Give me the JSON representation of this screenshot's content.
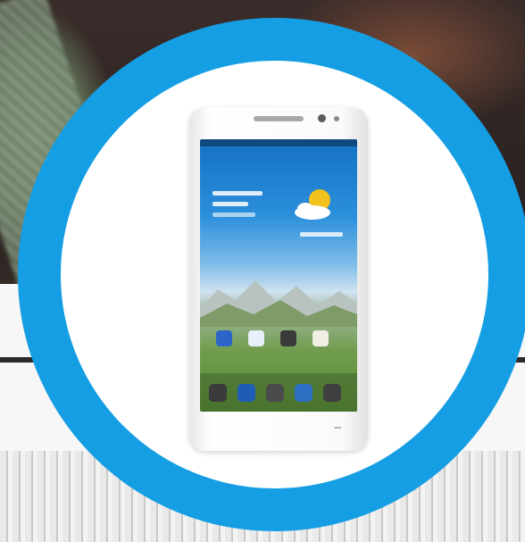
{
  "image": {
    "subject": "smartphone-in-blue-circle",
    "colors": {
      "ring": "#159ee3",
      "ring_inner": "#ffffff",
      "phone_body": "#fafafa",
      "background_dark": "#2a2220",
      "background_light": "#f7f7f7"
    },
    "icons": [
      "weather-sun-cloud-icon",
      "clock-widget-icon",
      "app-icon",
      "dock-icon"
    ]
  }
}
